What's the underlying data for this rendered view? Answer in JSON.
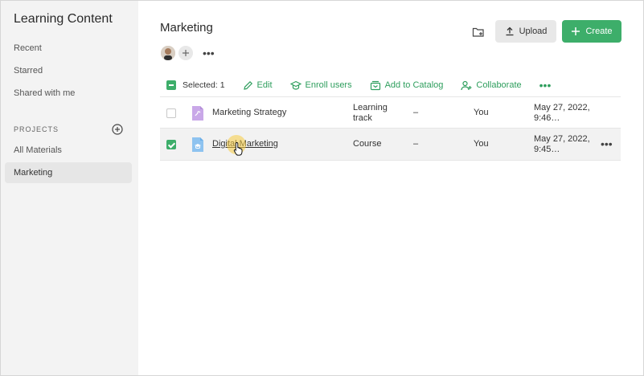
{
  "sidebar": {
    "title": "Learning Content",
    "nav": [
      "Recent",
      "Starred",
      "Shared with me"
    ],
    "projects_label": "PROJECTS",
    "projects": [
      "All Materials",
      "Marketing"
    ]
  },
  "header": {
    "title": "Marketing",
    "upload_label": "Upload",
    "create_label": "Create"
  },
  "toolbar": {
    "selected_label": "Selected: 1",
    "actions": [
      "Edit",
      "Enroll users",
      "Add to Catalog",
      "Collaborate"
    ],
    "more": "•••"
  },
  "table": {
    "rows": [
      {
        "name": "Marketing Strategy",
        "type": "Learning track",
        "extra": "–",
        "owner": "You",
        "modified": "May 27, 2022, 9:46…",
        "checked": false,
        "icon": "learning-track-icon",
        "icon_color": "#c9a8e8"
      },
      {
        "name": "Digital Marketing",
        "type": "Course",
        "extra": "–",
        "owner": "You",
        "modified": "May 27, 2022, 9:45…",
        "checked": true,
        "icon": "course-icon",
        "icon_color": "#8ec3f0"
      }
    ]
  },
  "colors": {
    "accent": "#3dae6a",
    "sidebar_bg": "#f3f3f3"
  }
}
